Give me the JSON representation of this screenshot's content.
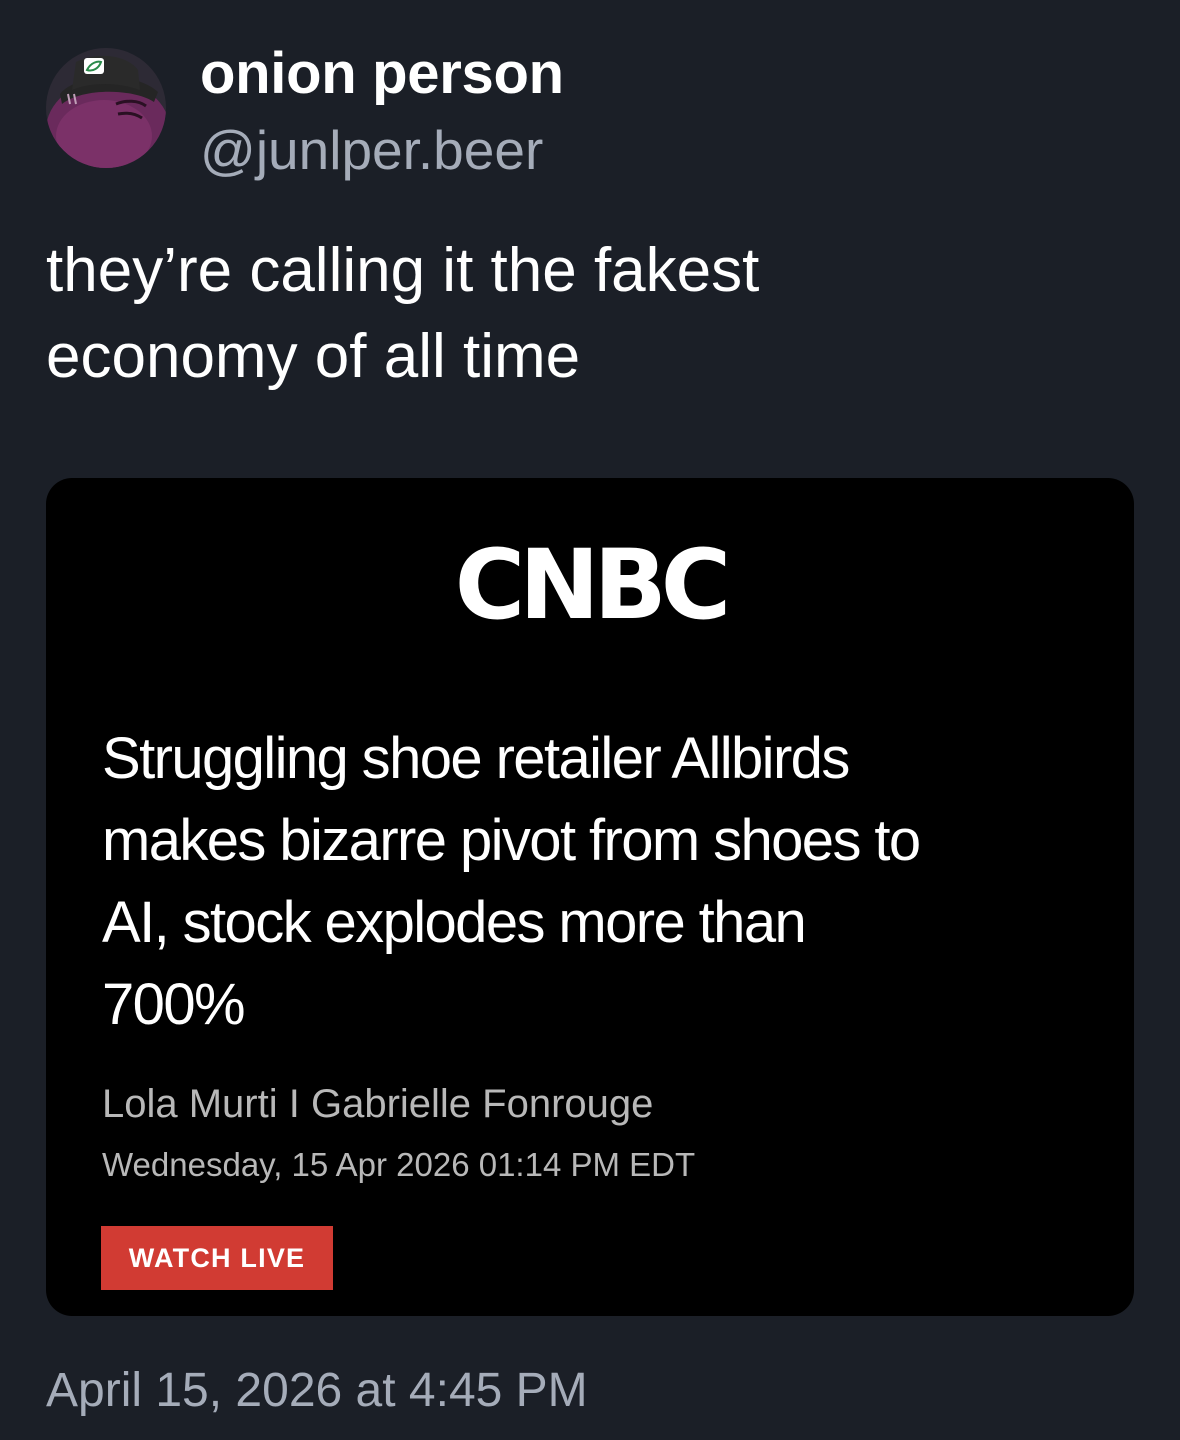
{
  "post": {
    "author": {
      "display_name": "onion person",
      "handle": "@junlper.beer",
      "avatar_icon": "onion-character-avatar"
    },
    "text_lines": [
      "they’re calling it the fakest",
      "economy of all time"
    ],
    "timestamp": "April 15, 2026 at 4:45 PM"
  },
  "card": {
    "logo_text": "CNBC",
    "headline_lines": [
      "Struggling shoe retailer Allbirds",
      "makes bizarre pivot from shoes to",
      "AI, stock explodes more than",
      "700%"
    ],
    "authors": "Lola Murti I Gabrielle Fonrouge",
    "datetime": "Wednesday, 15 Apr 2026 01:14 PM EDT",
    "watch_live_label": "WATCH LIVE"
  },
  "colors": {
    "background": "#1b1f27",
    "card_background": "#000000",
    "secondary_text": "#a5acb9",
    "watch_live": "#d13b33"
  }
}
